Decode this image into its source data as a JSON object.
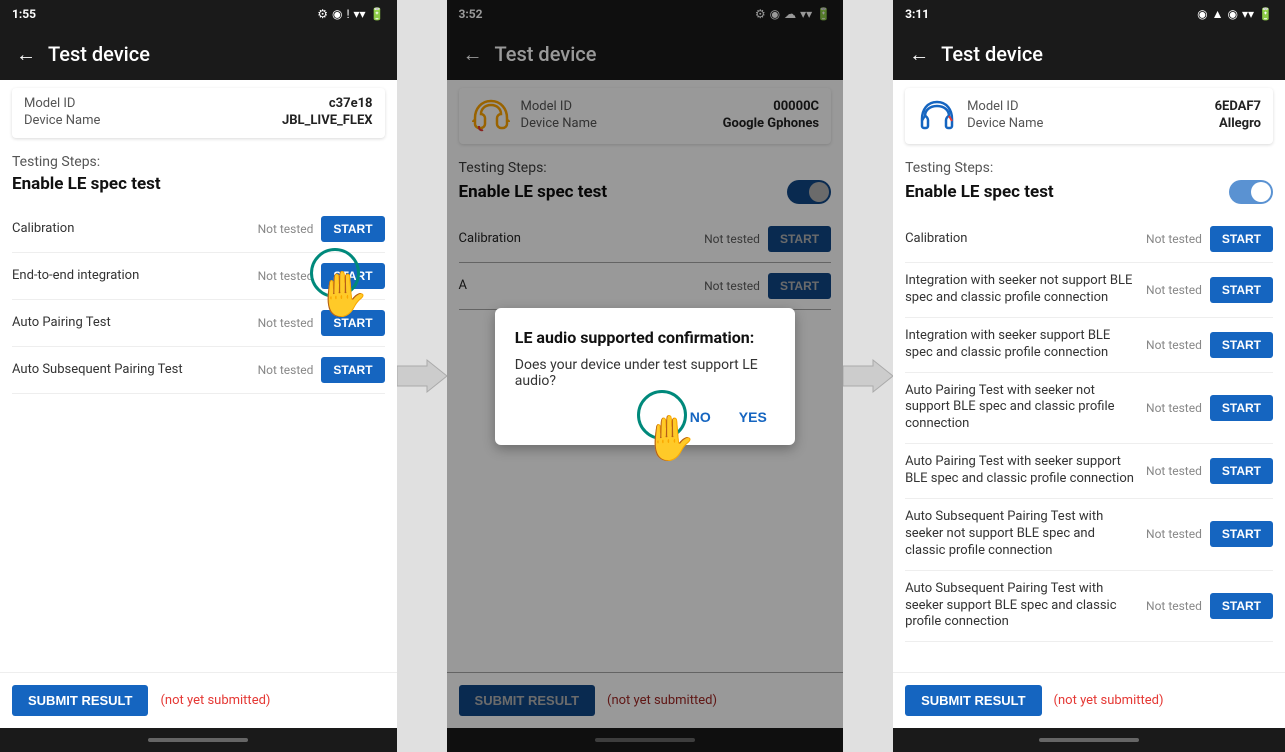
{
  "screen1": {
    "status_bar": {
      "time": "1:55",
      "icons": "⚙ ⊙ !"
    },
    "top_bar": {
      "title": "Test device",
      "back": "←"
    },
    "device": {
      "model_id_label": "Model ID",
      "model_id_value": "c37e18",
      "device_name_label": "Device Name",
      "device_name_value": "JBL_LIVE_FLEX"
    },
    "testing_steps_label": "Testing Steps:",
    "enable_le_label": "Enable LE spec test",
    "toggle_state": "off",
    "test_rows": [
      {
        "label": "Calibration",
        "status": "Not tested",
        "btn": "START"
      },
      {
        "label": "End-to-end integration",
        "status": "Not tested",
        "btn": "START"
      },
      {
        "label": "Auto Pairing Test",
        "status": "Not tested",
        "btn": "START"
      },
      {
        "label": "Auto Subsequent Pairing Test",
        "status": "Not tested",
        "btn": "START"
      }
    ],
    "submit_btn": "SUBMIT RESULT",
    "not_submitted": "(not yet submitted)"
  },
  "screen2": {
    "status_bar": {
      "time": "3:52",
      "icons": "⚙ ⊙ ☁"
    },
    "top_bar": {
      "title": "Test device",
      "back": "←"
    },
    "device": {
      "model_id_label": "Model ID",
      "model_id_value": "00000C",
      "device_name_label": "Device Name",
      "device_name_value": "Google Gphones"
    },
    "testing_steps_label": "Testing Steps:",
    "enable_le_label": "Enable LE spec test",
    "toggle_state": "on",
    "test_rows": [
      {
        "label": "Calibration",
        "status": "Not tested",
        "btn": "START"
      },
      {
        "label": "A",
        "status": "Not tested",
        "btn": "START"
      }
    ],
    "submit_btn": "SUBMIT RESULT",
    "not_submitted": "(not yet submitted)",
    "dialog": {
      "title": "LE audio supported confirmation:",
      "body": "Does your device under test support LE audio?",
      "no": "NO",
      "yes": "YES"
    }
  },
  "screen3": {
    "status_bar": {
      "time": "3:11",
      "icons": "⊙ ▲ ⊙"
    },
    "top_bar": {
      "title": "Test device",
      "back": "←"
    },
    "device": {
      "model_id_label": "Model ID",
      "model_id_value": "6EDAF7",
      "device_name_label": "Device Name",
      "device_name_value": "Allegro"
    },
    "testing_steps_label": "Testing Steps:",
    "enable_le_label": "Enable LE spec test",
    "toggle_state": "on",
    "test_rows": [
      {
        "label": "Calibration",
        "status": "Not tested",
        "btn": "START"
      },
      {
        "label": "Integration with seeker not support BLE spec and classic profile connection",
        "status": "Not tested",
        "btn": "START"
      },
      {
        "label": "Integration with seeker support BLE spec and classic profile connection",
        "status": "Not tested",
        "btn": "START"
      },
      {
        "label": "Auto Pairing Test with seeker not support BLE spec and classic profile connection",
        "status": "Not tested",
        "btn": "START"
      },
      {
        "label": "Auto Pairing Test with seeker support BLE spec and classic profile connection",
        "status": "Not tested",
        "btn": "START"
      },
      {
        "label": "Auto Subsequent Pairing Test with seeker not support BLE spec and classic profile connection",
        "status": "Not tested",
        "btn": "START"
      },
      {
        "label": "Auto Subsequent Pairing Test with seeker support BLE spec and classic profile connection",
        "status": "Not tested",
        "btn": "START"
      }
    ],
    "submit_btn": "SUBMIT RESULT",
    "not_submitted": "(not yet submitted)"
  },
  "icons": {
    "wifi": "▼",
    "battery": "🔋",
    "back_arrow": "←",
    "settings": "⚙",
    "alert": "!"
  }
}
